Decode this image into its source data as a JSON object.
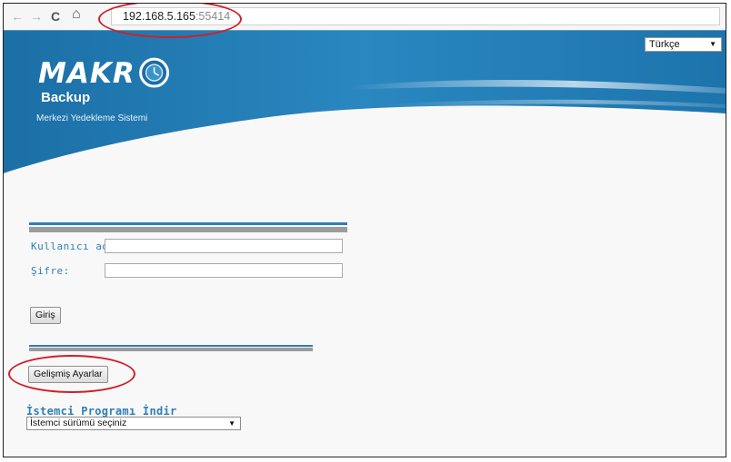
{
  "browser": {
    "back_icon": "←",
    "forward_icon": "→",
    "reload_icon": "C",
    "home_icon": "⌂",
    "url_host": "192.168.5.165",
    "url_port": ":55414"
  },
  "header": {
    "language": "Türkçe",
    "logo_text": "MAKR",
    "logo_sub": "Backup",
    "tagline": "Merkezi Yedekleme Sistemi"
  },
  "login": {
    "username_label": "Kullanıcı adı:",
    "password_label": "Şifre:",
    "submit_label": "Giriş"
  },
  "advanced": {
    "button_label": "Gelişmiş Ayarlar"
  },
  "download": {
    "title": "İstemci Programı İndir",
    "select_value": "İstemci sürümü seçiniz"
  },
  "colors": {
    "brand_blue": "#2e7fb8",
    "annotation_red": "#d0202a"
  }
}
